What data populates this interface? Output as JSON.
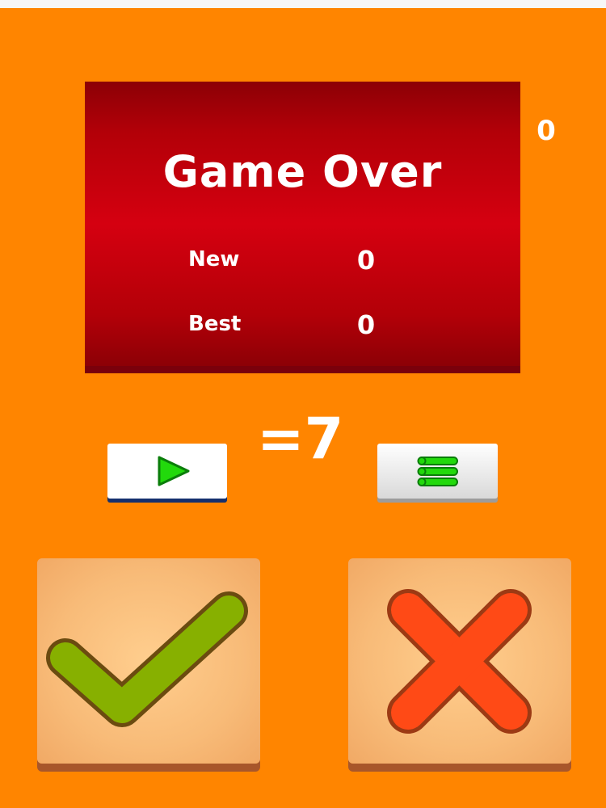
{
  "corner_score": "0",
  "panel": {
    "title": "Game Over",
    "new_label": "New",
    "new_value": "0",
    "best_label": "Best",
    "best_value": "0"
  },
  "equation": "=7",
  "buttons": {
    "play_icon": "play-icon",
    "menu_icon": "list-icon"
  },
  "answers": {
    "yes_icon": "checkmark-icon",
    "no_icon": "cross-icon"
  },
  "colors": {
    "background": "#ff8500",
    "panel_red": "#d50010",
    "check_green": "#87b000",
    "cross_red": "#ff4a16",
    "icon_green": "#22d90c"
  }
}
